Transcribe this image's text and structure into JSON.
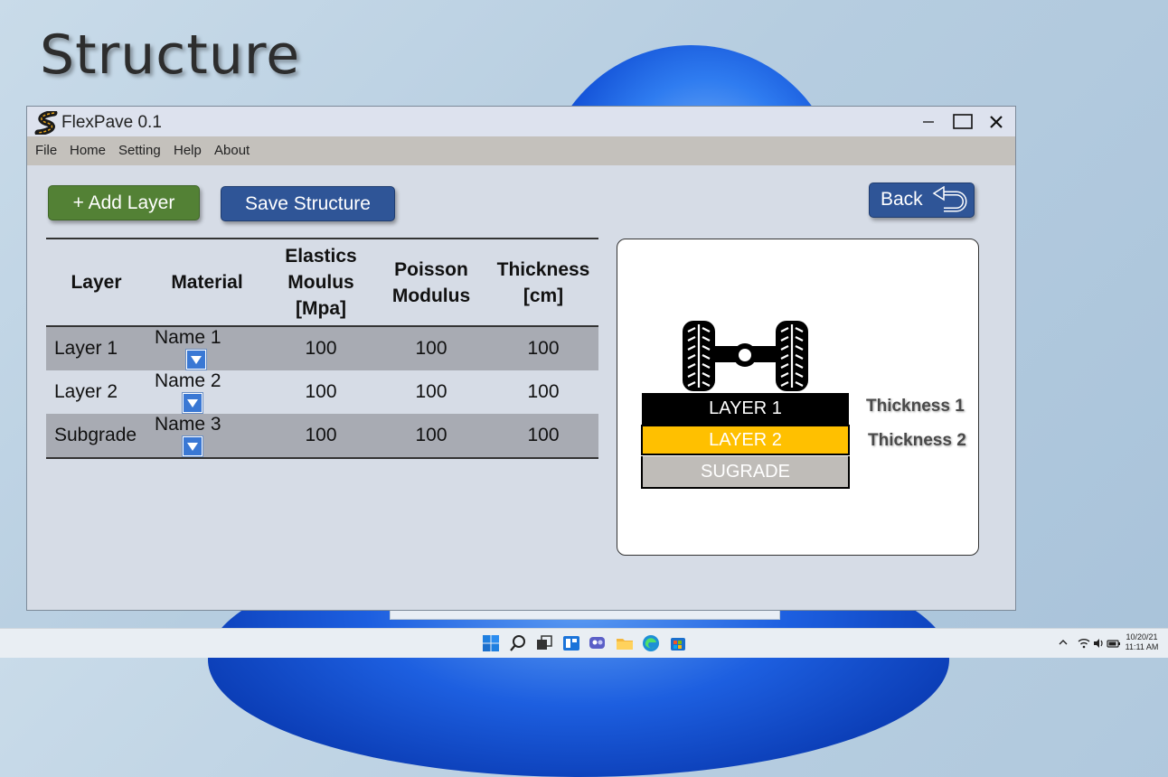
{
  "slide_title": "Structure",
  "window": {
    "title": "FlexPave 0.1",
    "controls": {
      "minimize": "–",
      "maximize": "☐",
      "close": "✕"
    }
  },
  "menu": [
    "File",
    "Home",
    "Setting",
    "Help",
    "About"
  ],
  "buttons": {
    "add_layer": "+  Add Layer",
    "save_structure": "Save Structure",
    "back": "Back"
  },
  "table": {
    "headers": {
      "layer": "Layer",
      "material": "Material",
      "elastic_line1": "Elastics",
      "elastic_line2": "Moulus",
      "elastic_line3": "[Mpa]",
      "poisson_line1": "Poisson",
      "poisson_line2": "Modulus",
      "thickness_line1": "Thickness",
      "thickness_line2": "[cm]"
    },
    "rows": [
      {
        "layer": "Layer 1",
        "material": "Name 1",
        "elastic": "100",
        "poisson": "100",
        "thickness": "100"
      },
      {
        "layer": "Layer 2",
        "material": "Name 2",
        "elastic": "100",
        "poisson": "100",
        "thickness": "100"
      },
      {
        "layer": "Subgrade",
        "material": "Name 3",
        "elastic": "100",
        "poisson": "100",
        "thickness": "100"
      }
    ]
  },
  "diagram": {
    "layer1": "LAYER 1",
    "layer2": "LAYER 2",
    "subgrade": "SUGRADE",
    "thickness1": "Thickness 1",
    "thickness2": "Thickness 2"
  },
  "taskbar": {
    "date": "10/20/21",
    "time": "11:11 AM"
  },
  "colors": {
    "add_button": "#538135",
    "save_button": "#2f5597",
    "layer2_fill": "#ffc000",
    "subgrade_fill": "#bfbcb8"
  }
}
